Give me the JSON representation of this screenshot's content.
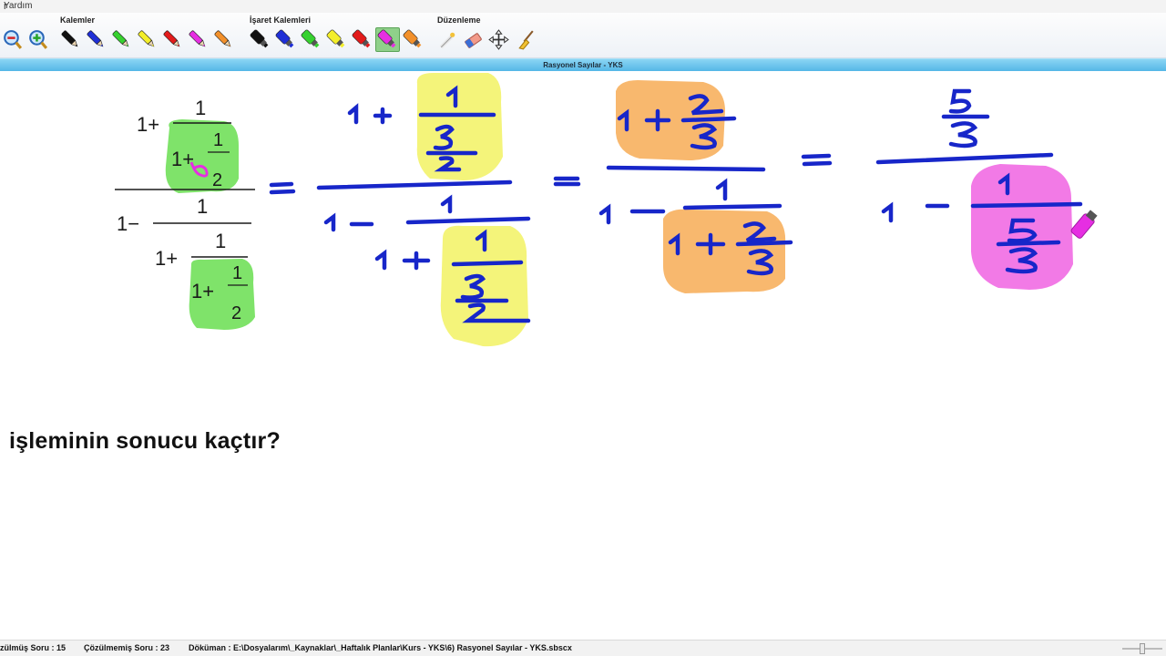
{
  "menu": {
    "partial_label": "r",
    "help_label": "Yardım"
  },
  "ribbon": {
    "groups": [
      {
        "title": "Kalemler"
      },
      {
        "title": "İşaret Kalemleri"
      },
      {
        "title": "Düzenleme"
      }
    ],
    "pens": [
      "black-pen",
      "blue-pen",
      "green-pen",
      "yellow-pen",
      "red-pen",
      "magenta-pen",
      "orange-pen"
    ],
    "pen_colors": [
      "#111111",
      "#1f2fd6",
      "#36d12f",
      "#f3ee2a",
      "#e21b1b",
      "#e62ee2",
      "#f2902b"
    ],
    "markers": [
      "black-marker",
      "blue-marker",
      "green-marker",
      "yellow-marker",
      "red-marker",
      "magenta-marker",
      "orange-marker"
    ],
    "marker_colors": [
      "#111111",
      "#1f2fd6",
      "#36d12f",
      "#f3ee2a",
      "#e21b1b",
      "#e62ee2",
      "#f2902b"
    ],
    "active_marker": "magenta-marker"
  },
  "document": {
    "title": "Rasyonel Sayılar - YKS"
  },
  "problem": {
    "one": "1",
    "two": "2",
    "three": "3",
    "five": "5",
    "one_plus": "1+",
    "one_minus": "1−",
    "question": "işleminin sonucu kaçtır?"
  },
  "colors": {
    "ink": "#1726c9",
    "green_highlight": "#7fe36a",
    "yellow_highlight": "#f4f47a",
    "orange_highlight": "#f8b86e",
    "pink_highlight": "#f27ae6"
  },
  "status": {
    "solved": "zülmüş Soru : 15",
    "unsolved": "Çözülmemiş Soru : 23",
    "document_path": "Döküman : E:\\Dosyalarım\\_Kaynaklar\\_Haftalık Planlar\\Kurs - YKS\\6) Rasyonel Sayılar - YKS.sbscx"
  }
}
